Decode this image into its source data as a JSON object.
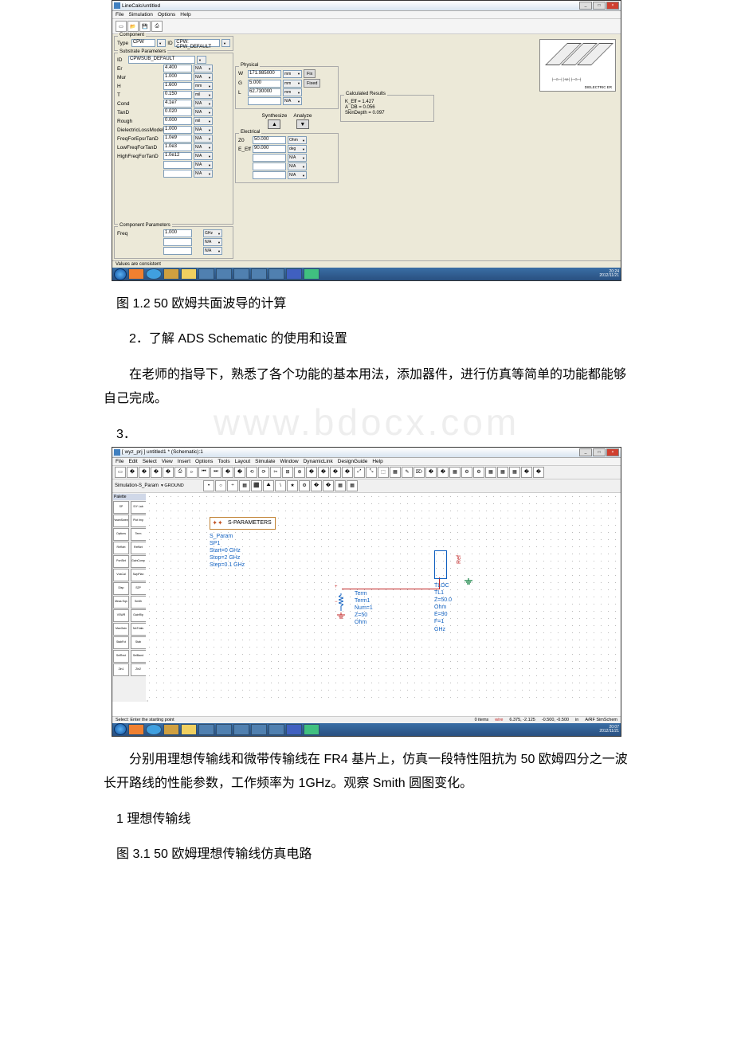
{
  "linecalc": {
    "title": "LineCalc/untitled",
    "menus": [
      "File",
      "Simulation",
      "Options",
      "Help"
    ],
    "component": {
      "legend": "Component",
      "typeLabel": "Type",
      "type": "CPW",
      "idLabel": "ID",
      "id": "CPW: CPW_DEFAULT"
    },
    "substrate": {
      "legend": "Substrate Parameters",
      "idLabel": "ID",
      "id": "CPWSUB_DEFAULT",
      "rows": [
        {
          "l": "Er",
          "v": "4.400",
          "u": "N/A"
        },
        {
          "l": "Mur",
          "v": "1.000",
          "u": "N/A"
        },
        {
          "l": "H",
          "v": "1.600",
          "u": "mm"
        },
        {
          "l": "T",
          "v": "0.150",
          "u": "mil"
        },
        {
          "l": "Cond",
          "v": "4.1e7",
          "u": "N/A"
        },
        {
          "l": "TanD",
          "v": "0.020",
          "u": "N/A"
        },
        {
          "l": "Rough",
          "v": "0.000",
          "u": "mil"
        },
        {
          "l": "DielectricLossModel",
          "v": "1.000",
          "u": "N/A"
        },
        {
          "l": "FreqForEpsrTanD",
          "v": "1.0e9",
          "u": "N/A"
        },
        {
          "l": "LowFreqForTanD",
          "v": "1.0e3",
          "u": "N/A"
        },
        {
          "l": "HighFreqForTanD",
          "v": "1.0e12",
          "u": "N/A"
        }
      ]
    },
    "compParams": {
      "legend": "Component Parameters",
      "freqLabel": "Freq",
      "freq": "1.000",
      "freqUnit": "GHz"
    },
    "physical": {
      "legend": "Physical",
      "rows": [
        {
          "l": "W",
          "v": "171.985000",
          "u": "mm",
          "b": "Fix"
        },
        {
          "l": "G",
          "v": "5.000",
          "u": "mm",
          "b": "Fixed"
        },
        {
          "l": "L",
          "v": "62.730000",
          "u": "mm",
          "b": ""
        }
      ]
    },
    "synth": {
      "s": "Synthesize",
      "a": "Analyze"
    },
    "electrical": {
      "legend": "Electrical",
      "rows": [
        {
          "l": "Z0",
          "v": "50.000",
          "u": "Ohm"
        },
        {
          "l": "E_Eff",
          "v": "90.000",
          "u": "deg"
        }
      ]
    },
    "results": {
      "legend": "Calculated Results",
      "lines": [
        "K_Eff = 1.427",
        "A_DB = 0.056",
        "SkinDepth = 0.097"
      ]
    },
    "diagram": {
      "diel": "DIELECTRIC  ER"
    },
    "status": "Values are consistent",
    "clock": {
      "t": "20:24",
      "d": "2012/11/21"
    }
  },
  "doc": {
    "cap1": "图 1.2 50 欧姆共面波导的计算",
    "p2": "2．了解 ADS Schematic 的使用和设置",
    "p3": "在老师的指导下，熟悉了各个功能的基本用法，添加器件，进行仿真等简单的功能都能够自己完成。",
    "p4": "3．",
    "watermark": "www.bdocx.com",
    "p5": "分别用理想传输线和微带传输线在 FR4 基片上，仿真一段特性阻抗为 50 欧姆四分之一波长开路线的性能参数，工作频率为 1GHz。观察 Smith 圆图变化。",
    "p6": "1 理想传输线",
    "cap3": "图 3.1 50 欧姆理想传输线仿真电路"
  },
  "ads": {
    "title": "[ wyz_prj ] untitled1 * (Schematic):1",
    "menus": [
      "File",
      "Edit",
      "Select",
      "View",
      "Insert",
      "Options",
      "Tools",
      "Layout",
      "Simulate",
      "Window",
      "DynamicLink",
      "DesignGuide",
      "Help"
    ],
    "simLabel": "Simulation-S_Param",
    "simVal": "▾  GROUND",
    "palTitle": "Palette",
    "palItems": [
      "SP",
      "S/Y Lab",
      "ParamSweep",
      "Plot Imp",
      "Options",
      "Term",
      "RefNet",
      "RefNet",
      "PortSet",
      "GainComp",
      "VnaCal",
      "SwpPlan",
      "Disp",
      "S2P",
      "Meas Eqn",
      "Smith",
      "VSWR",
      "GainRip",
      "MaxGain",
      "McTrials",
      "StabFct",
      "Stab",
      "SelRect",
      "SelBand",
      "Zin1",
      "Zin2"
    ],
    "sparam": {
      "title": "S-PARAMETERS",
      "lines": [
        "S_Param",
        "SP1",
        "Start=0 GHz",
        "Stop=2 GHz",
        "Step=0.1 GHz"
      ]
    },
    "term": {
      "lines": [
        "Term",
        "Term1",
        "Num=1",
        "Z=50 Ohm"
      ]
    },
    "ref": "Ref",
    "tloc": {
      "lines": [
        "TLOC",
        "TL1",
        "Z=50.0 Ohm",
        "E=90",
        "F=1 GHz"
      ]
    },
    "status": {
      "l": "Select: Enter the starting point",
      "items": "0 items",
      "wire": "wire",
      "c1": "6.375, -2.125",
      "c2": "-0.500, -0.500",
      "u": "in",
      "lib": "A/RF  SimSchem"
    },
    "clock": {
      "t": "20:07",
      "d": "2012/11/21"
    }
  }
}
